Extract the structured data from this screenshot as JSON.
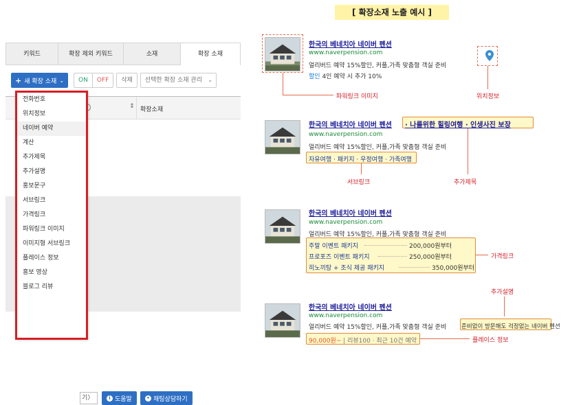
{
  "left": {
    "tabs": [
      {
        "label": "키워드"
      },
      {
        "label": "확장 제외 키워드"
      },
      {
        "label": "소재"
      },
      {
        "label": "확장 소재"
      }
    ],
    "toolbar": {
      "add_label": "새 확장 소재",
      "on_label": "ON",
      "off_label": "OFF",
      "delete_label": "삭제",
      "manage_placeholder": "선택한 확장 소재 관리"
    },
    "table": {
      "col_label": "확장소재"
    },
    "dropdown": [
      "전화번호",
      "위치정보",
      "네이버 예약",
      "계산",
      "추가제목",
      "추가설명",
      "홍보문구",
      "서브링크",
      "가격링크",
      "파워링크 이미지",
      "이미지형 서브링크",
      "플레이스 정보",
      "홍보 영상",
      "블로그 리뷰"
    ],
    "bottom": {
      "nav_fragment": "기〉",
      "help_label": "도움말",
      "chat_label": "채팅상담하기"
    }
  },
  "right": {
    "title": "[ 확장소재 노출 예시 ]",
    "ad_title": "한국의 베네치아 네이버 펜션",
    "ad_url": "www.naverpension.com",
    "ad_desc": "얼리버드 예약 15%할인, 커플,가족 맞춤형 객실 준비",
    "ex1": {
      "promo_prefix": "할인",
      "promo_text": "4인 예약 시 추가 10%",
      "label_image": "파워링크 이미지",
      "label_location": "위치정보"
    },
    "ex2": {
      "extra_title": "· 나를위한 힐링여행 · 인생사진 보장",
      "sublinks": "자유여행 · 패키지 · 우정여행 · 가족여행",
      "label_sublink": "서브링크",
      "label_extra_title": "추가제목"
    },
    "ex3": {
      "rows": [
        {
          "name": "주말 이벤트 패키지",
          "price": "200,000원부터"
        },
        {
          "name": "프로포즈 이벤트 패키지",
          "price": "250,000원부터"
        },
        {
          "name": "히노끼탕 + 조식 제공 패키지",
          "price": "350,000원부터"
        }
      ],
      "label_price": "가격링크"
    },
    "ex4": {
      "desc_tail": "준비없이 방문해도 걱정없는 네이버 펜션",
      "price_text": "90,000원~",
      "review_text": " | 리뷰100 · 최근 10건 예약",
      "label_extra_desc": "추가설명",
      "label_place": "플레이스 정보"
    }
  },
  "colors": {
    "accent_blue": "#2e6fc4",
    "highlight_red": "#d61d25",
    "title_yellow": "#fff3a8",
    "url_green": "#1a8a3a"
  }
}
